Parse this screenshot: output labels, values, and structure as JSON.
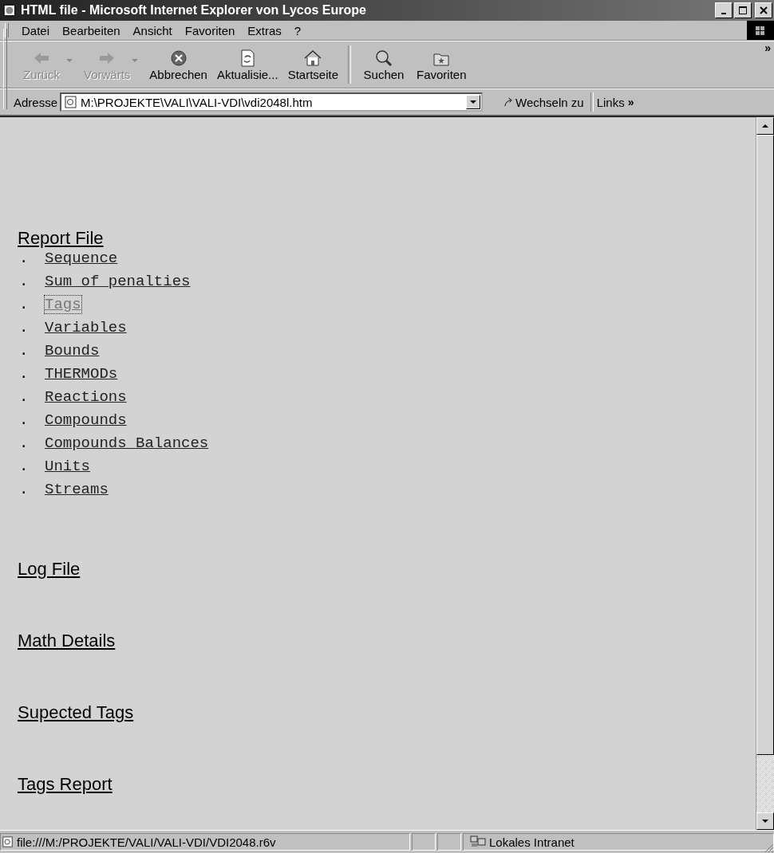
{
  "window": {
    "title": "HTML file - Microsoft Internet Explorer von Lycos Europe"
  },
  "menu": [
    "Datei",
    "Bearbeiten",
    "Ansicht",
    "Favoriten",
    "Extras",
    "?"
  ],
  "toolbar": {
    "buttons": [
      {
        "kind": "back",
        "label": "Zurück",
        "disabled": true,
        "dropdown": true
      },
      {
        "kind": "forward",
        "label": "Vorwärts",
        "disabled": true,
        "dropdown": true
      },
      {
        "kind": "stop",
        "label": "Abbrechen",
        "disabled": false,
        "dropdown": false
      },
      {
        "kind": "refresh",
        "label": "Aktualisie...",
        "disabled": false,
        "dropdown": false
      },
      {
        "kind": "home",
        "label": "Startseite",
        "disabled": false,
        "dropdown": false
      },
      {
        "kind": "search",
        "label": "Suchen",
        "disabled": false,
        "dropdown": false
      },
      {
        "kind": "favorites",
        "label": "Favoriten",
        "disabled": false,
        "dropdown": false
      }
    ],
    "more": "»"
  },
  "address_bar": {
    "label": "Adresse",
    "value": "M:\\PROJEKTE\\VALI\\VALI-VDI\\vdi2048l.htm",
    "go": "Wechseln zu",
    "links": "Links",
    "more": "»"
  },
  "content": {
    "sections": [
      {
        "title": "Report File",
        "items": [
          {
            "label": "Sequence",
            "visited": false,
            "focused": false
          },
          {
            "label": "Sum of penalties",
            "visited": false,
            "focused": false
          },
          {
            "label": "Tags",
            "visited": true,
            "focused": true
          },
          {
            "label": "Variables",
            "visited": false,
            "focused": false
          },
          {
            "label": "Bounds",
            "visited": false,
            "focused": false
          },
          {
            "label": "THERMODs",
            "visited": false,
            "focused": false
          },
          {
            "label": "Reactions",
            "visited": false,
            "focused": false
          },
          {
            "label": "Compounds",
            "visited": false,
            "focused": false
          },
          {
            "label": "Compounds_Balances",
            "visited": false,
            "focused": false
          },
          {
            "label": "Units",
            "visited": false,
            "focused": false
          },
          {
            "label": "Streams",
            "visited": false,
            "focused": false
          }
        ]
      },
      {
        "title": "Log File"
      },
      {
        "title": "Math Details"
      },
      {
        "title": "Supected Tags"
      },
      {
        "title": "Tags Report"
      }
    ],
    "bullet": "."
  },
  "status_bar": {
    "text": "file:///M:/PROJEKTE/VALI/VALI-VDI/VDI2048.r6v",
    "zone": "Lokales Intranet"
  }
}
